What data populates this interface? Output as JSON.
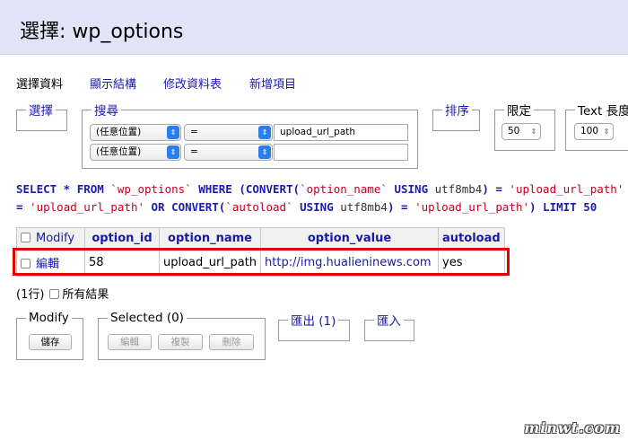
{
  "header": {
    "title": "選擇: wp_options"
  },
  "tabs": [
    {
      "label": "選擇資料",
      "active": true
    },
    {
      "label": "顯示結構",
      "active": false
    },
    {
      "label": "修改資料表",
      "active": false
    },
    {
      "label": "新增項目",
      "active": false
    }
  ],
  "select_box": {
    "legend": "選擇"
  },
  "search_box": {
    "legend": "搜尋",
    "rows": [
      {
        "column": "(任意位置)",
        "operator": "=",
        "value": "upload_url_path"
      },
      {
        "column": "(任意位置)",
        "operator": "=",
        "value": ""
      }
    ]
  },
  "sort_box": {
    "legend": "排序"
  },
  "limit_box": {
    "legend": "限定",
    "value": "50"
  },
  "text_box": {
    "legend": "Text 長度",
    "value": "100"
  },
  "sql": {
    "line1": [
      {
        "t": "SELECT * FROM ",
        "c": "kw"
      },
      {
        "t": "`wp_options`",
        "c": "str"
      },
      {
        "t": " WHERE (CONVERT(",
        "c": "kw"
      },
      {
        "t": "`option_name`",
        "c": "str"
      },
      {
        "t": " USING ",
        "c": "kw"
      },
      {
        "t": "utf8mb4",
        "c": "plain"
      },
      {
        "t": ") = ",
        "c": "kw"
      },
      {
        "t": "'upload_url_path'",
        "c": "str"
      }
    ],
    "line2": [
      {
        "t": "= ",
        "c": "kw"
      },
      {
        "t": "'upload_url_path'",
        "c": "str"
      },
      {
        "t": " OR CONVERT(",
        "c": "kw"
      },
      {
        "t": "`autoload`",
        "c": "str"
      },
      {
        "t": " USING ",
        "c": "kw"
      },
      {
        "t": "utf8mb4",
        "c": "plain"
      },
      {
        "t": ") = ",
        "c": "kw"
      },
      {
        "t": "'upload_url_path'",
        "c": "str"
      },
      {
        "t": ") LIMIT 50",
        "c": "kw"
      }
    ]
  },
  "table": {
    "modify_header": "Modify",
    "columns": [
      "option_id",
      "option_name",
      "option_value",
      "autoload"
    ],
    "rows": [
      {
        "edit": "編輯",
        "option_id": "58",
        "option_name": "upload_url_path",
        "option_value": "http://img.hualieninews.com",
        "autoload": "yes"
      }
    ]
  },
  "result_count": {
    "text": "(1行)",
    "all_results_label": "所有結果"
  },
  "modify_box": {
    "legend": "Modify",
    "save_label": "儲存"
  },
  "selected_box": {
    "legend": "Selected (0)",
    "edit_label": "編輯",
    "copy_label": "複製",
    "delete_label": "刪除"
  },
  "export_box": {
    "legend": "匯出 (1)"
  },
  "import_box": {
    "legend": "匯入"
  },
  "watermark": "minwt.com",
  "colors": {
    "header_bg": "#e4e4f8",
    "link": "#1a1aa8",
    "highlight": "#e30000",
    "sql_string": "#c4001c"
  }
}
